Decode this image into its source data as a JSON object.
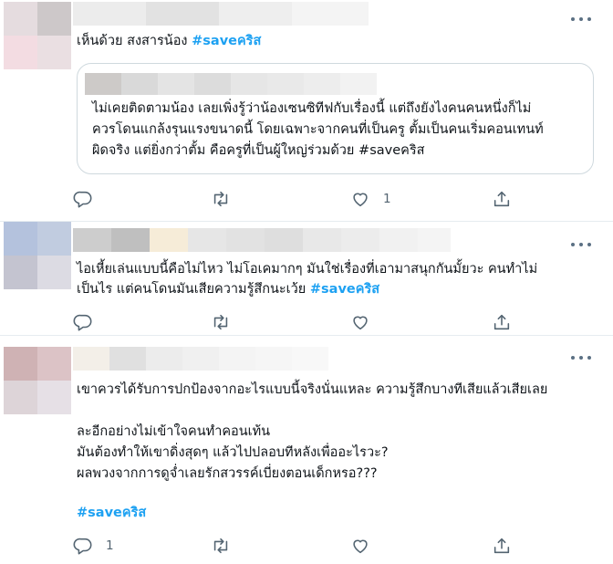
{
  "tweets": [
    {
      "text": "เห็นด้วย สงสารน้อง ",
      "hashtag": "#saveคริส",
      "quote": {
        "text": "ไม่เคยติดตามน้อง เลยเพิ่งรู้ว่าน้องเซนซิทีฟกับเรื่องนี้ แต่ถึงยังไงคนคนหนึ่งก็ไม่\nควรโดนแกล้งรุนแรงขนาดนี้ โดยเฉพาะจากคนที่เป็นครู ตั้มเป็นคนเริ่มคอนเทนท์\nผิดจริง แต่ยิ่งกว่าตั้ม คือครูที่เป็นผู้ใหญ่ร่วมด้วย #saveคริส"
      },
      "reply_count": "",
      "retweet_count": "",
      "like_count": "1"
    },
    {
      "text": "ไอเหี้ยเล่นแบบนี้คือไม่ไหว ไม่โอเคมากๆ มันใช่เรื่องที่เอามาสนุกกันมั้ยวะ คนทำไม่\nเป็นไร แต่คนโดนมันเสียความรู้สึกนะเว้ย ",
      "hashtag": "#saveคริส",
      "reply_count": "",
      "retweet_count": "",
      "like_count": ""
    },
    {
      "text": "เขาควรได้รับการปกป้องจากอะไรแบบนี้จริงนั่นแหละ ความรู้สึกบางทีเสียแล้วเสียเลย\n\nละอีกอย่างไม่เข้าใจคนทำคอนเท้น\nมันต้องทำให้เขาดิ่งสุดๆ แล้วไปปลอบทีหลังเพื่ออะไรวะ?\nผลพวงจากการดูจ่ำเลยรักสวรรค์เบี่ยงตอนเด็กหรอ???",
      "hashtag": "#saveคริส",
      "reply_count": "1",
      "retweet_count": "",
      "like_count": ""
    }
  ],
  "icons": {
    "reply": "reply-icon",
    "retweet": "retweet-icon",
    "like": "heart-icon",
    "share": "share-icon",
    "more": "more-icon"
  },
  "colors": {
    "hashtag": "#1da1f2",
    "icon": "#536471",
    "divider": "#e6ecf0",
    "quote_border": "#cfd9de"
  }
}
